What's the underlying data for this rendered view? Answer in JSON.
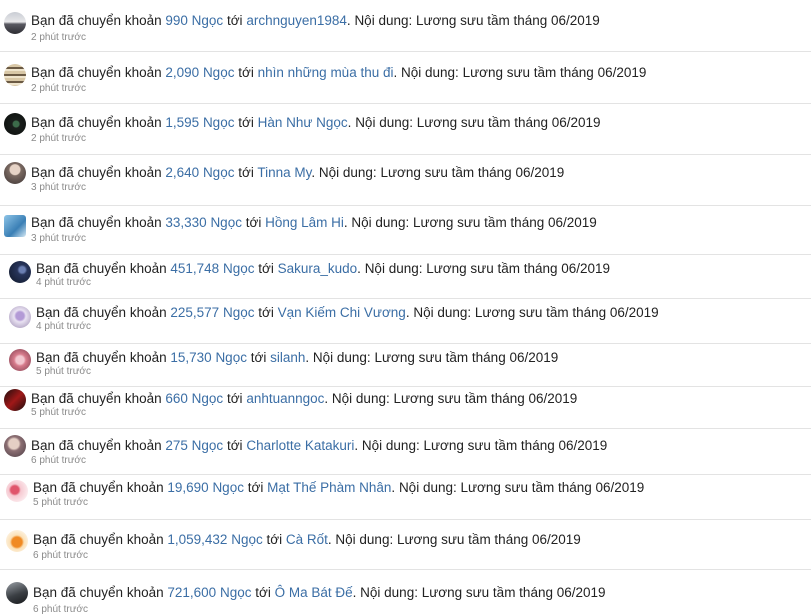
{
  "text": {
    "prefix": "Bạn đã chuyển khoản",
    "unit": "Ngọc",
    "to": "tới",
    "content_label": "Nội dung:",
    "content": "Lương sưu tầm tháng 06/2019"
  },
  "items": [
    {
      "amount": "990",
      "user": "archnguyen1984",
      "time": "2 phút trước",
      "avatar": "avatar-landscape-icon"
    },
    {
      "amount": "2,090",
      "user": "nhìn những mùa thu đi",
      "time": "2 phút trước",
      "avatar": "avatar-stripes-icon"
    },
    {
      "amount": "1,595",
      "user": "Hàn Như Ngọc",
      "time": "2 phút trước",
      "avatar": "avatar-space-icon"
    },
    {
      "amount": "2,640",
      "user": "Tinna My",
      "time": "3 phút trước",
      "avatar": "avatar-person-icon"
    },
    {
      "amount": "33,330",
      "user": "Hồng Lâm Hi",
      "time": "3 phút trước",
      "avatar": "avatar-device-icon"
    },
    {
      "amount": "451,748",
      "user": "Sakura_kudo",
      "time": "4 phút trước",
      "avatar": "avatar-night-icon"
    },
    {
      "amount": "225,577",
      "user": "Vạn Kiếm Chi Vương",
      "time": "4 phút trước",
      "avatar": "avatar-character-icon"
    },
    {
      "amount": "15,730",
      "user": "silanh",
      "time": "5 phút trước",
      "avatar": "avatar-pink-icon"
    },
    {
      "amount": "660",
      "user": "anhtuanngoc",
      "time": "5 phút trước",
      "avatar": "avatar-red-dark-icon"
    },
    {
      "amount": "275",
      "user": "Charlotte Katakuri",
      "time": "6 phút trước",
      "avatar": "avatar-anime-icon"
    },
    {
      "amount": "19,690",
      "user": "Mạt Thế Phàm Nhân",
      "time": "5 phút trước",
      "avatar": "avatar-flowers-icon"
    },
    {
      "amount": "1,059,432",
      "user": "Cà Rốt",
      "time": "6 phút trước",
      "avatar": "avatar-carrot-icon"
    },
    {
      "amount": "721,600",
      "user": "Ô Ma Bát Đế",
      "time": "6 phút trước",
      "avatar": "avatar-car-icon"
    }
  ]
}
